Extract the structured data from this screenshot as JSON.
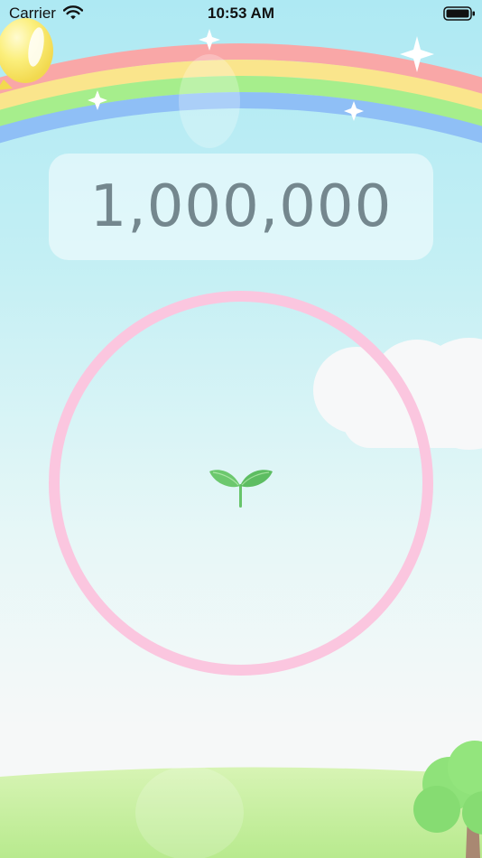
{
  "status_bar": {
    "carrier": "Carrier",
    "time": "10:53 AM",
    "icons": [
      "wifi-icon",
      "battery-icon"
    ]
  },
  "counter": {
    "value": "1,000,000"
  },
  "tap_ring": {
    "icon": "sprout-icon"
  },
  "colors": {
    "sky_top": "#aee9f3",
    "counter_text": "#74878e",
    "ring": "#fbc6df",
    "sprout": "#6cc86e",
    "grass": "#c9f0a5"
  }
}
